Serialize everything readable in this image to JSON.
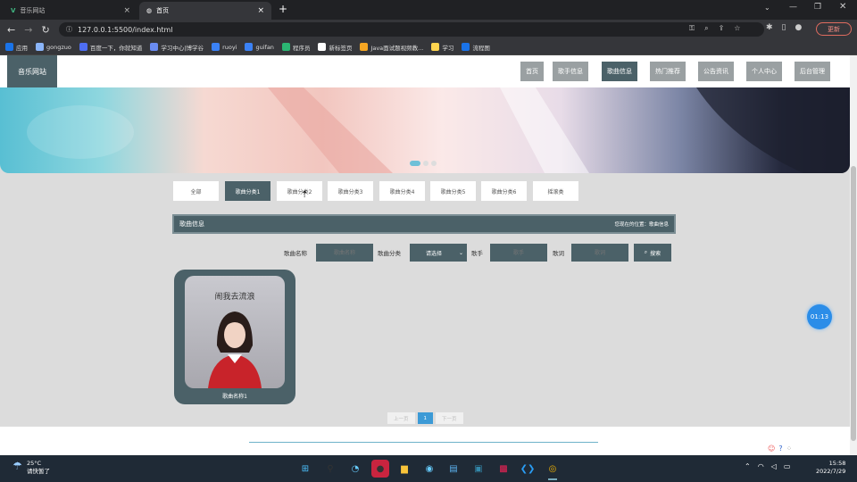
{
  "browser": {
    "tabs": [
      {
        "title": "音乐网站",
        "close": "×"
      },
      {
        "title": "首页",
        "close": "×"
      }
    ],
    "new_tab": "+",
    "url": "127.0.0.1:5500/index.html",
    "update_label": "更新",
    "bookmarks": [
      {
        "label": "应用",
        "color": "#1a73e8"
      },
      {
        "label": "gongzuo",
        "color": "#8ab4f8"
      },
      {
        "label": "百度一下，你就知道",
        "color": "#4e6ef2"
      },
      {
        "label": "学习中心|博学谷",
        "color": "#6a8cf2"
      },
      {
        "label": "ruoyi",
        "color": "#3b82f6"
      },
      {
        "label": "guifan",
        "color": "#3b82f6"
      },
      {
        "label": "程序员",
        "color": "#2bb673"
      },
      {
        "label": "新标签页",
        "color": "#ffffff"
      },
      {
        "label": "Java面试题视频教...",
        "color": "#f5a623"
      },
      {
        "label": "学习",
        "color": "#ffd54f"
      },
      {
        "label": "流程图",
        "color": "#1a73e8"
      }
    ]
  },
  "site": {
    "logo": "音乐网站",
    "nav": [
      "首页",
      "歌手信息",
      "歌曲信息",
      "热门推荐",
      "公告资讯",
      "个人中心",
      "后台管理"
    ],
    "nav_active": 2,
    "categories": [
      "全部",
      "歌曲分类1",
      "歌曲分类2",
      "歌曲分类3",
      "歌曲分类4",
      "歌曲分类5",
      "歌曲分类6",
      "摇滚类"
    ],
    "category_active": 1,
    "section_title": "歌曲信息",
    "breadcrumb": "您现在的位置：歌曲信息",
    "filters": {
      "name_label": "歌曲名称",
      "name_placeholder": "歌曲名称",
      "cat_label": "歌曲分类",
      "cat_value": "请选择",
      "singer_label": "歌手",
      "singer_placeholder": "歌手",
      "lyric_label": "歌词",
      "lyric_placeholder": "歌词",
      "search": "搜索"
    },
    "song": {
      "name": "歌曲名称1",
      "cover_title": "闹我去流浪"
    },
    "pager": {
      "prev": "上一页",
      "current": "1",
      "next": "下一页"
    },
    "timer": "01:13"
  },
  "taskbar": {
    "temp": "25°C",
    "weather": "请快暂了",
    "time": "15:58",
    "date": "2022/7/29"
  }
}
